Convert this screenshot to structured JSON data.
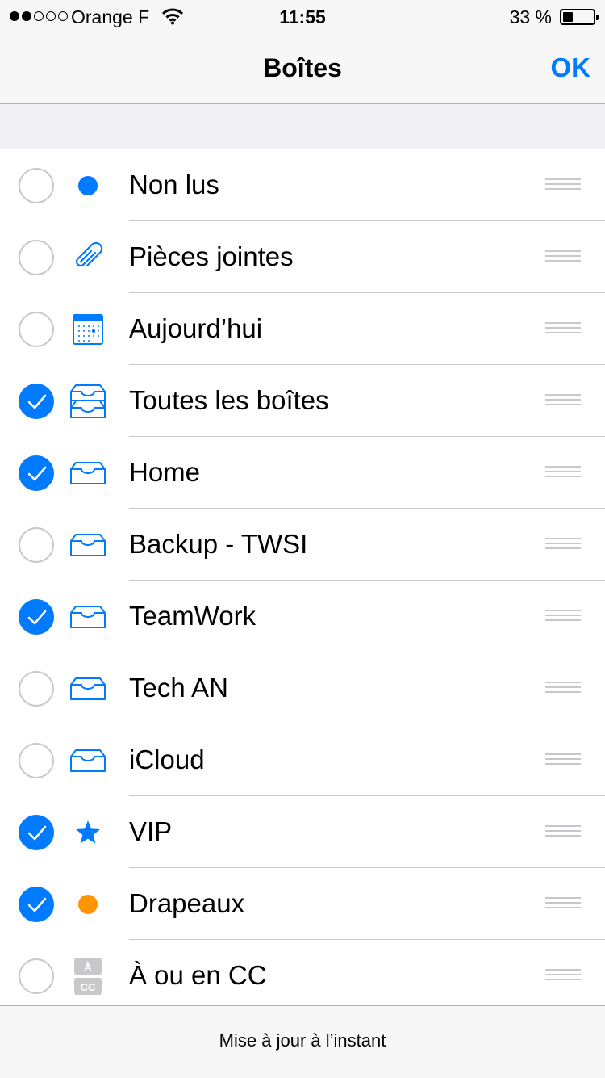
{
  "status": {
    "carrier": "Orange F",
    "time": "11:55",
    "battery": "33 %",
    "battery_level": 0.33
  },
  "nav": {
    "title": "Boîtes",
    "ok_label": "OK"
  },
  "mailboxes": [
    {
      "label": "Non lus",
      "checked": false,
      "icon": "unread-dot-icon"
    },
    {
      "label": "Pièces jointes",
      "checked": false,
      "icon": "paperclip-icon"
    },
    {
      "label": "Aujourd’hui",
      "checked": false,
      "icon": "calendar-icon"
    },
    {
      "label": "Toutes les boîtes",
      "checked": true,
      "icon": "all-inboxes-icon"
    },
    {
      "label": "Home",
      "checked": true,
      "icon": "inbox-tray-icon"
    },
    {
      "label": "Backup - TWSI",
      "checked": false,
      "icon": "inbox-tray-icon"
    },
    {
      "label": "TeamWork",
      "checked": true,
      "icon": "inbox-tray-icon"
    },
    {
      "label": "Tech AN",
      "checked": false,
      "icon": "inbox-tray-icon"
    },
    {
      "label": "iCloud",
      "checked": false,
      "icon": "inbox-tray-icon"
    },
    {
      "label": "VIP",
      "checked": true,
      "icon": "star-icon"
    },
    {
      "label": "Drapeaux",
      "checked": true,
      "icon": "flag-dot-icon"
    },
    {
      "label": "À ou en CC",
      "checked": false,
      "icon": "to-cc-icon",
      "icon_text": [
        "À",
        "CC"
      ]
    }
  ],
  "colors": {
    "accent": "#007aff",
    "flag": "#ff9500",
    "unchecked_border": "#c7c7cc",
    "cc_badge": "#c7c7cc"
  },
  "toolbar": {
    "status": "Mise à jour à l’instant"
  }
}
